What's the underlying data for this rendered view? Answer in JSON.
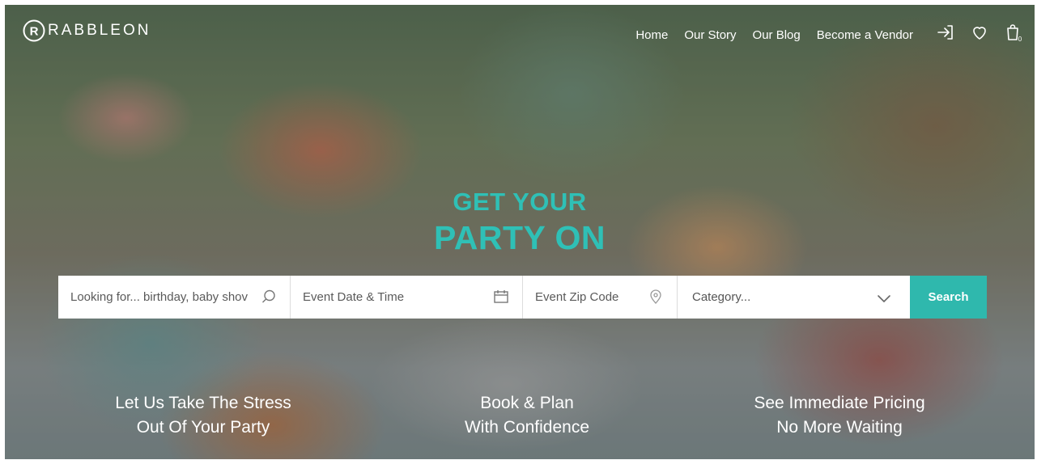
{
  "brand": {
    "logo_letter": "R",
    "name": "RABBLEON"
  },
  "nav": {
    "links": [
      "Home",
      "Our Story",
      "Our Blog",
      "Become a Vendor"
    ],
    "icons": [
      "login-icon",
      "heart-icon",
      "cart-icon"
    ],
    "cart_count": "0"
  },
  "hero": {
    "line1": "GET YOUR",
    "line2": "PARTY ON"
  },
  "search": {
    "query_placeholder": "Looking for... birthday, baby shov",
    "date_placeholder": "Event Date & Time",
    "zip_placeholder": "Event Zip Code",
    "category_selected": "Category...",
    "button_label": "Search"
  },
  "features": [
    {
      "line1": "Let Us Take The Stress",
      "line2": "Out Of Your Party"
    },
    {
      "line1": "Book & Plan",
      "line2": "With Confidence"
    },
    {
      "line1": "See Immediate Pricing",
      "line2": "No More Waiting"
    }
  ],
  "colors": {
    "accent": "#2fb8ad",
    "headline": "#2fc0b6",
    "text_light": "#ffffff"
  }
}
